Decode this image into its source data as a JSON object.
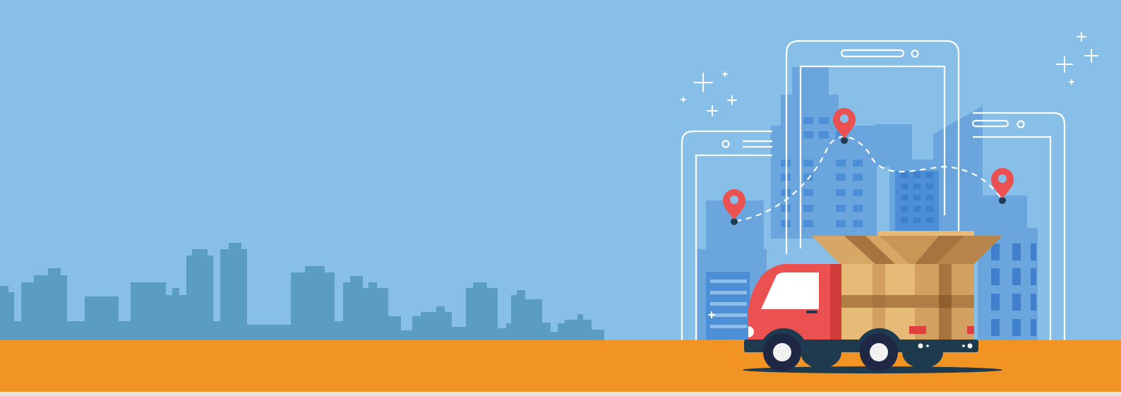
{
  "scene": {
    "description_label": "",
    "colors": {
      "sky": "#87bfe9",
      "skyline_left": "#5a9cc2",
      "buildings_right": "#6aa6dd",
      "buildings_right_dark": "#4d8fd6",
      "road": "#f29423",
      "road_edge": "#e9e4dc",
      "phone_outline": "#ffffff",
      "pin": "#ea5150",
      "pin_dot": "#1f3a50",
      "truck_cab": "#ea5150",
      "truck_cab_dark": "#d13c3b",
      "truck_window": "#ffffff",
      "truck_chassis": "#1d3a4f",
      "wheel_tire": "#1e2744",
      "wheel_hub": "#f1f1f1",
      "box_light": "#e6bb78",
      "box_mid": "#d2a061",
      "box_dark": "#b07e45",
      "tape": "#a7733e"
    },
    "icons": [
      "location-pin-icon",
      "sparkle-plus-icon",
      "smartphone-icon",
      "delivery-truck-icon",
      "cardboard-box-icon"
    ]
  }
}
